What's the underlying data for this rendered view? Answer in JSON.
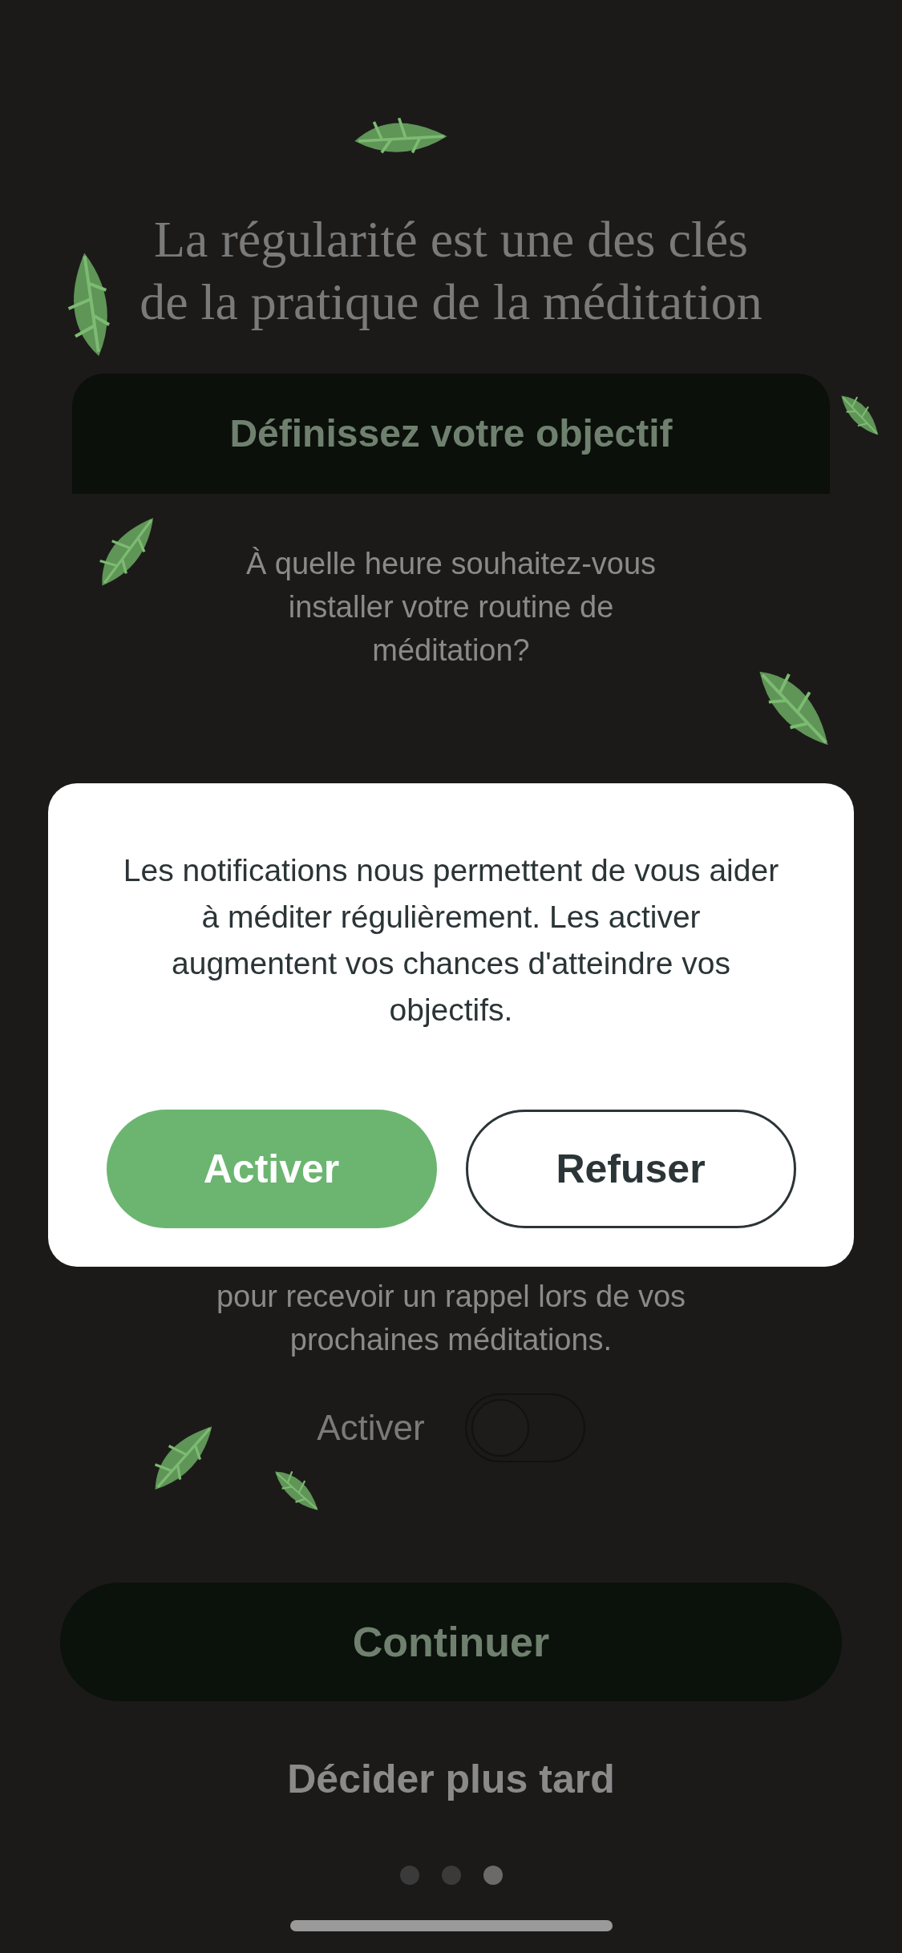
{
  "title": "La régularité est une des clés de la pratique de la méditation",
  "goal_card": {
    "title": "Définissez votre objectif"
  },
  "question": "À quelle heure souhaitez-vous installer votre routine de méditation?",
  "reminder_text": "pour recevoir un rappel lors de vos prochaines méditations.",
  "reminder_toggle": {
    "label": "Activer",
    "on": false
  },
  "continue_button": "Continuer",
  "later_link": "Décider plus tard",
  "page_dots": [
    {
      "selected": false
    },
    {
      "selected": false
    },
    {
      "selected": true
    }
  ],
  "dialog": {
    "message": "Les notifications nous permettent de vous aider à méditer régulièrement. Les activer augmentent vos chances d'atteindre vos objectifs.",
    "buttons": [
      {
        "label": "Activer",
        "kind": "primary"
      },
      {
        "label": "Refuser",
        "kind": "secondary"
      }
    ]
  }
}
